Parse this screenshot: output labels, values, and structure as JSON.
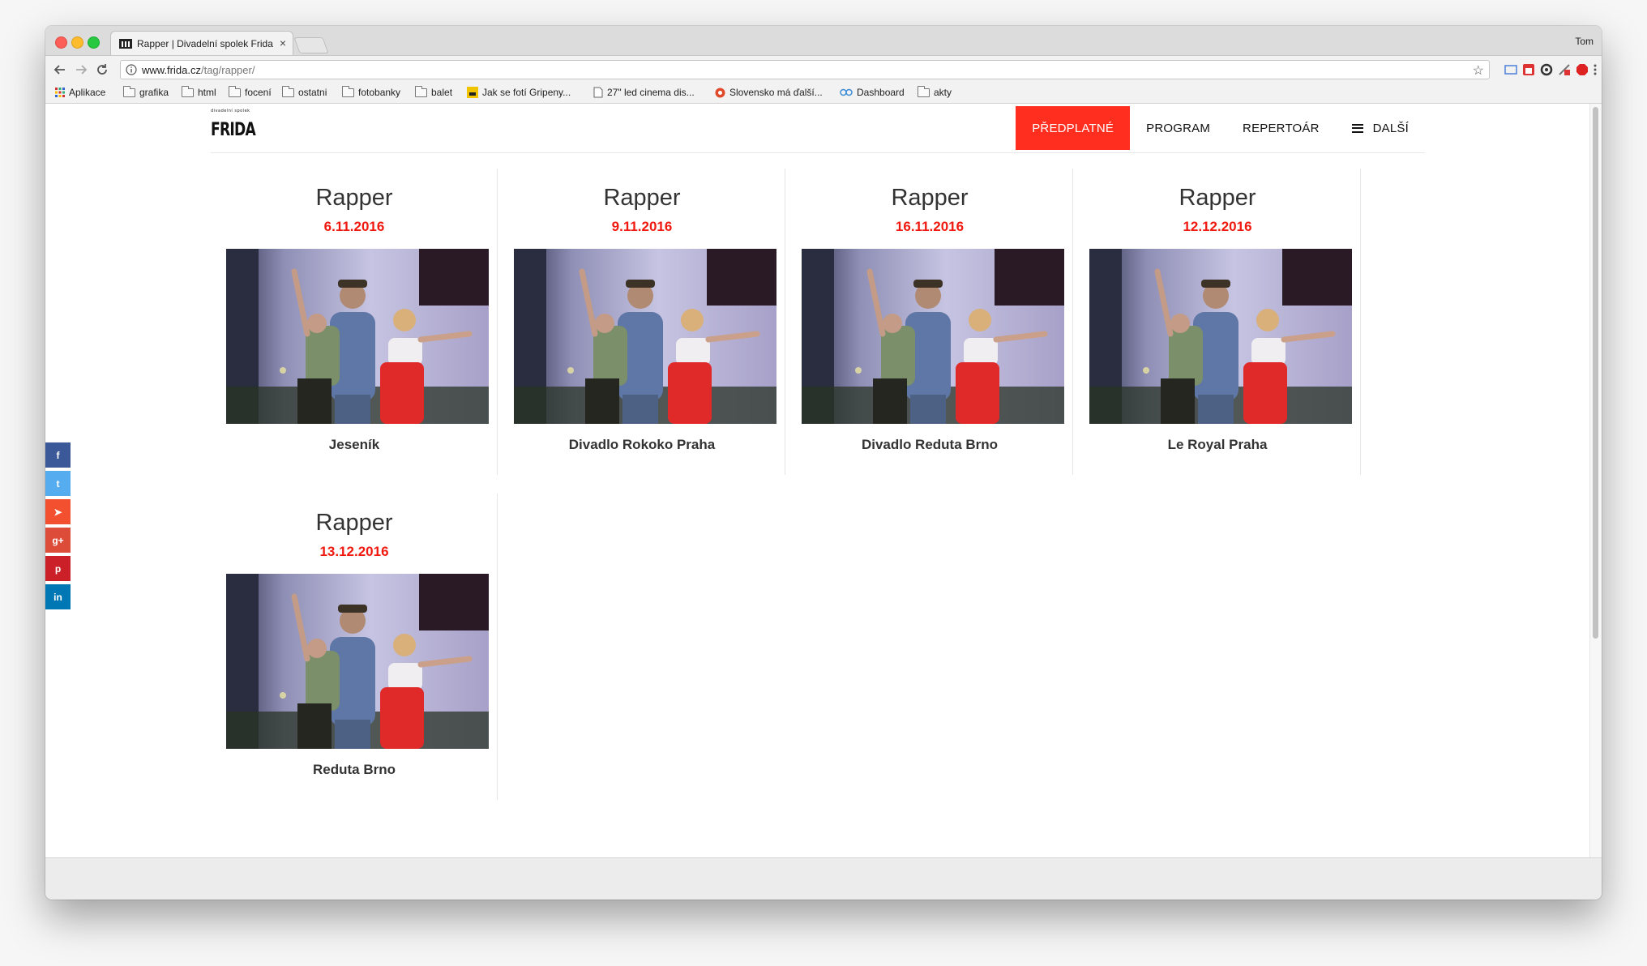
{
  "browser": {
    "tab_title": "Rapper | Divadelní spolek Frida",
    "tab_close": "×",
    "profile": "Tom",
    "url_domain": "www.frida.cz",
    "url_path": "/tag/rapper/",
    "star": "☆",
    "bookmarks": [
      "Aplikace",
      "grafika",
      "html",
      "focení",
      "ostatni",
      "fotobanky",
      "balet",
      "Jak se fotí Gripeny...",
      "27\" led cinema dis...",
      "Slovensko má ďalší...",
      "Dashboard",
      "akty"
    ]
  },
  "site": {
    "logo_small": "divadelní spolek",
    "logo_text": "FRIDA",
    "nav": [
      "PŘEDPLATNÉ",
      "PROGRAM",
      "REPERTOÁR",
      "DALŠÍ"
    ]
  },
  "social": [
    {
      "label": "f",
      "color": "#3b5998",
      "icon": "facebook-icon"
    },
    {
      "label": "t",
      "color": "#55acee",
      "icon": "twitter-icon"
    },
    {
      "label": "➤",
      "color": "#f3502f",
      "icon": "telegram-icon"
    },
    {
      "label": "g+",
      "color": "#dd4b39",
      "icon": "google-plus-icon"
    },
    {
      "label": "p",
      "color": "#cb2027",
      "icon": "pinterest-icon"
    },
    {
      "label": "in",
      "color": "#0077b5",
      "icon": "linkedin-icon"
    }
  ],
  "cards": [
    {
      "title": "Rapper",
      "date": "6.11.2016",
      "venue": "Jeseník"
    },
    {
      "title": "Rapper",
      "date": "9.11.2016",
      "venue": "Divadlo Rokoko Praha"
    },
    {
      "title": "Rapper",
      "date": "16.11.2016",
      "venue": "Divadlo Reduta Brno"
    },
    {
      "title": "Rapper",
      "date": "12.12.2016",
      "venue": "Le Royal Praha"
    },
    {
      "title": "Rapper",
      "date": "13.12.2016",
      "venue": "Reduta Brno"
    }
  ],
  "colors": {
    "accent": "#ff2e1f",
    "date": "#f0190f"
  }
}
